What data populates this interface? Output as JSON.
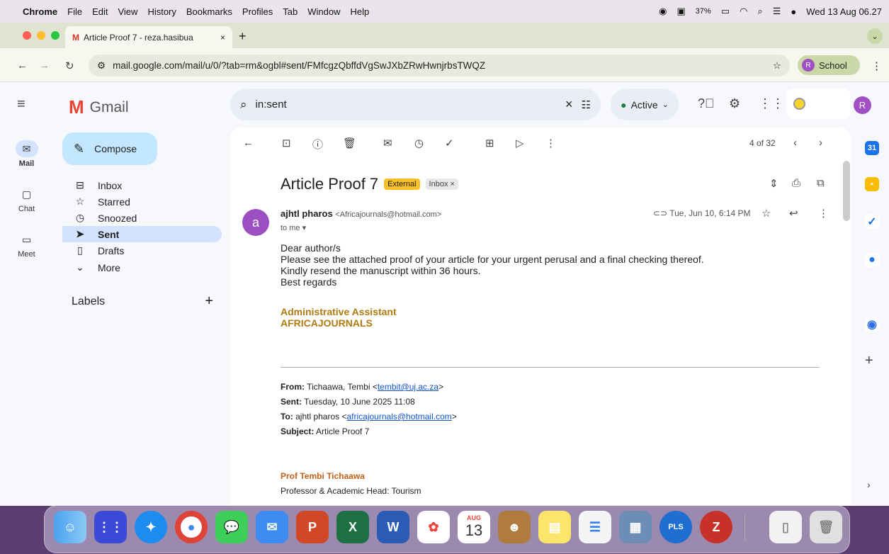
{
  "menubar": {
    "app": "Chrome",
    "items": [
      "File",
      "Edit",
      "View",
      "History",
      "Bookmarks",
      "Profiles",
      "Tab",
      "Window",
      "Help"
    ],
    "battery": "37%",
    "clock": "Wed 13 Aug 06.27"
  },
  "browser": {
    "tab_title": "Article Proof 7 - reza.hasibua",
    "url": "mail.google.com/mail/u/0/?tab=rm&ogbl#sent/FMfcgzQbffdVgSwJXbZRwHwnjrbsTWQZ",
    "profile_name": "School",
    "profile_initial": "R"
  },
  "rail": {
    "mail": "Mail",
    "chat": "Chat",
    "meet": "Meet"
  },
  "gmail": {
    "logo_text": "Gmail",
    "compose": "Compose",
    "nav": [
      {
        "label": "Inbox"
      },
      {
        "label": "Starred"
      },
      {
        "label": "Snoozed"
      },
      {
        "label": "Sent"
      },
      {
        "label": "Drafts"
      },
      {
        "label": "More"
      }
    ],
    "labels_heading": "Labels",
    "search_value": "in:sent",
    "status": "Active",
    "avatar": "R"
  },
  "email": {
    "counter": "4 of 32",
    "subject": "Article Proof 7",
    "badge_external": "External",
    "badge_inbox": "Inbox ×",
    "sender_initial": "a",
    "sender_name": "ajhtl pharos",
    "sender_email": "<Africajournals@hotmail.com>",
    "to": "to me",
    "date": "Tue, Jun 10, 6:14 PM",
    "body": [
      "Dear author/s",
      "Please see the attached proof of your article for your urgent perusal and a final checking thereof.",
      "Kindly resend the manuscript within 36 hours.",
      "Best regards"
    ],
    "signature": [
      "Administrative Assistant",
      "AFRICAJOURNALS"
    ],
    "forward": {
      "from_label": "From:",
      "from_name": "Tichaawa, Tembi",
      "from_email": "tembit@uj.ac.za",
      "sent_label": "Sent:",
      "sent_value": "Tuesday, 10 June 2025 11:08",
      "to_label": "To:",
      "to_name": "ajhtl pharos",
      "to_email": "africajournals@hotmail.com",
      "subject_label": "Subject:",
      "subject_value": "Article Proof 7"
    },
    "prof_name": "Prof Tembi Tichaawa",
    "prof_title": "Professor & Academic Head: Tourism"
  },
  "dock": {
    "calendar_month": "AUG",
    "calendar_day": "13",
    "pls": "PLS"
  },
  "colors": {
    "accent": "#c2e7ff",
    "selected": "#d3e3fd",
    "badge_external": "#f6c026",
    "signature": "#b07b10"
  }
}
